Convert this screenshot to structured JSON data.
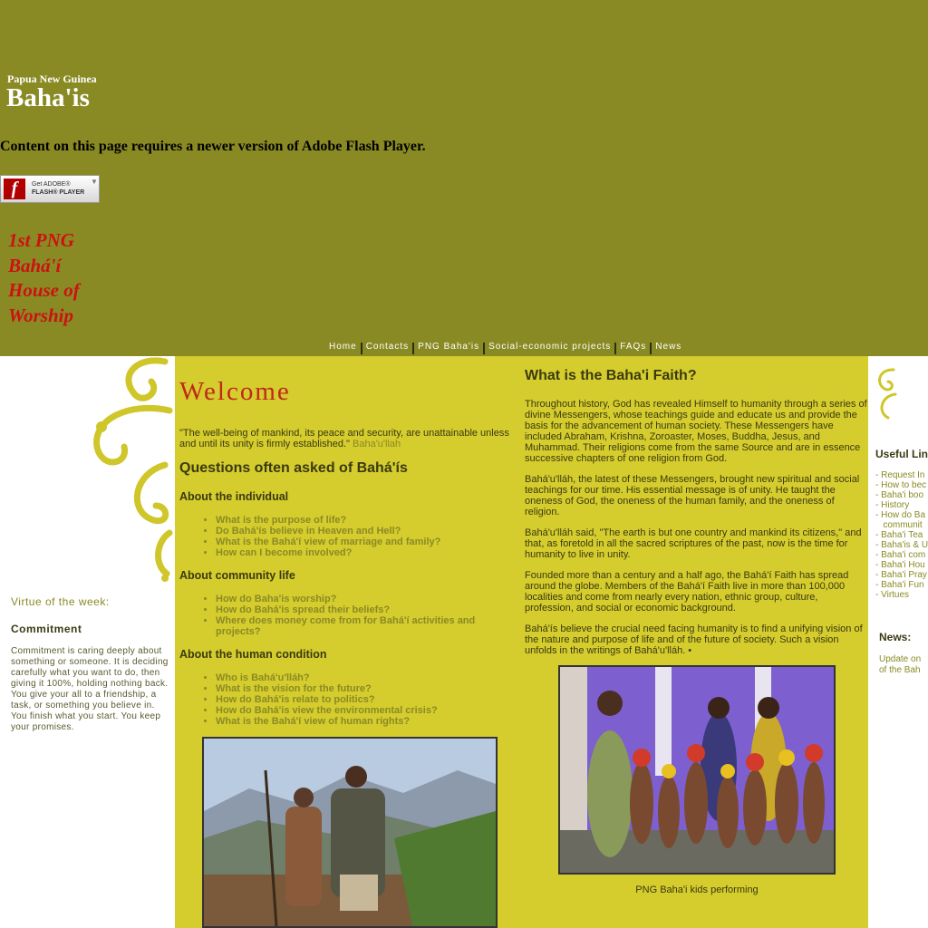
{
  "header": {
    "logo_small": "Papua New Guinea",
    "logo_big": "Baha'is",
    "flash_message": "Content on this page requires a newer version of Adobe Flash Player.",
    "flash_button_line1": "Get ADOBE®",
    "flash_button_line2": "FLASH® PLAYER",
    "house_title": [
      "1st PNG",
      "Bahá'í",
      "House of",
      "Worship"
    ]
  },
  "nav": {
    "items": [
      "Home",
      "Contacts",
      "PNG Baha'is",
      "Social-economic projects",
      "FAQs",
      "News"
    ]
  },
  "virtue": {
    "label": "Virtue of the week:",
    "name": "Commitment",
    "text": "Commitment is caring deeply about something or someone. It is deciding carefully what you want to do, then giving it 100%, holding nothing back. You give your all to a friendship, a task, or something you believe in. You finish what you start. You keep your promises."
  },
  "main": {
    "welcome": "Welcome",
    "quote": "\"The well-being of mankind, its peace and security, are unattainable unless and until its unity is firmly established.\"",
    "quote_author": "Baha'u'llah",
    "questions_heading": "Questions often asked of Bahá'ís",
    "sections": [
      {
        "heading": "About the individual",
        "questions": [
          "What is the purpose of life?",
          "Do Bahá'ís believe in Heaven and Hell?",
          "What is the Bahá'í view of marriage and family?",
          "How can I become involved?"
        ]
      },
      {
        "heading": "About community life",
        "questions": [
          "How do Baha'is worship?",
          "How do Bahá'is spread their beliefs?",
          "Where does money come from for Bahá'í activities and projects?"
        ]
      },
      {
        "heading": "About the human condition",
        "questions": [
          "Who is Bahá'u'lláh?",
          "What is the vision for the future?",
          "How do Bahá'is relate to politics?",
          "How do Bahá'is view the environmental crisis?",
          "What is the Bahá'í view of human rights?"
        ]
      }
    ]
  },
  "faith": {
    "heading": "What is the Baha'i Faith?",
    "paragraphs": [
      "Throughout history, God has revealed Himself to humanity through a series of divine Messengers, whose teachings guide and educate us and provide the basis for the advancement of human society. These Messengers have included Abraham, Krishna, Zoroaster, Moses, Buddha, Jesus, and Muhammad. Their religions come from the same Source and are in essence successive chapters of one religion from God.",
      "Bahá'u'lláh, the latest of these Messengers, brought new spiritual and social teachings for our time. His essential message is of unity. He taught the oneness of God, the oneness of the human family, and the oneness of religion.",
      "Bahá'u'lláh said, \"The earth is but one country and mankind its citizens,\" and that, as foretold in all the sacred scriptures of the past, now is the time for humanity to live in unity.",
      "Founded more than a century and a half ago, the Bahá'í Faith has spread around the globe. Members of the Bahá'í Faith live in more than 100,000 localities and come from nearly every nation, ethnic group, culture, profession, and social or economic background.",
      "Bahá'ís believe the crucial need facing humanity is to find a unifying vision of the nature and purpose of life and of the future of society. Such a vision unfolds in the writings of Bahá'u'lláh.  •"
    ],
    "photo_caption": "PNG Baha'i kids performing"
  },
  "sidebar_right": {
    "useful_links_heading": "Useful Lin",
    "links": [
      "- Request In",
      "- How to bec",
      "- Baha'i boo",
      "- History",
      "- How do Ba",
      "   communit",
      "- Baha'i Tea",
      "- Baha'is & U",
      "- Baha'i com",
      "- Baha'i Hou",
      "- Baha'i Pray",
      "- Baha'i Fun",
      "- Virtues"
    ],
    "news_heading": "News:",
    "news_lines": [
      "Update on",
      "of the Bah"
    ]
  },
  "colors": {
    "header_bg": "#8a8a24",
    "content_bg": "#d5cc2e",
    "accent_red": "#c0281a",
    "link_olive": "#8a8a24"
  }
}
